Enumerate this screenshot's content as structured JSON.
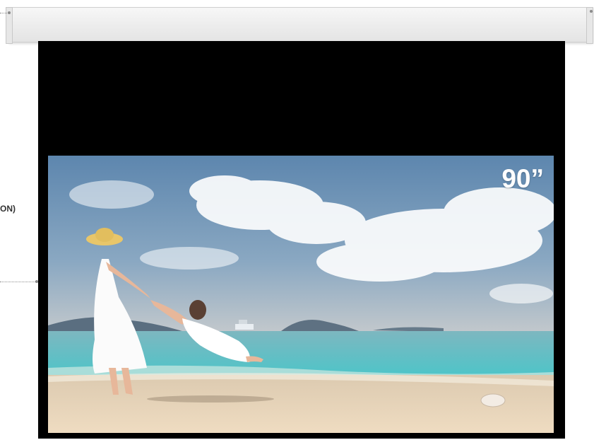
{
  "screen": {
    "size_label": "90”",
    "side_label": "ON)"
  },
  "scene": {
    "description_icon": "beach-photo",
    "sky_color": "#6b93b8",
    "sea_color": "#5fc3c4",
    "sand_color": "#e6d2b5"
  }
}
